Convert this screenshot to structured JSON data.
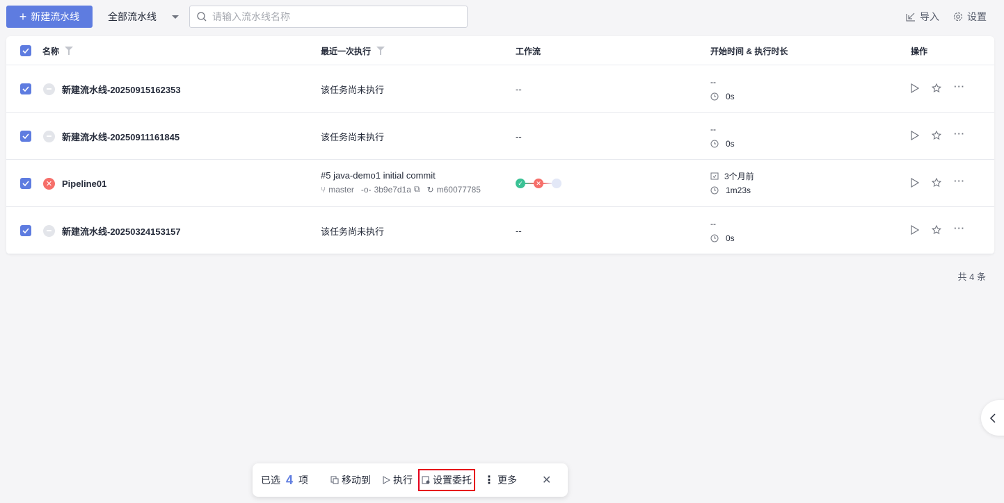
{
  "toolbar": {
    "new_label": "新建流水线",
    "scope": "全部流水线",
    "search_placeholder": "请输入流水线名称",
    "import_label": "导入",
    "settings_label": "设置"
  },
  "table": {
    "headers": {
      "name": "名称",
      "last_run": "最近一次执行",
      "workflow": "工作流",
      "time": "开始时间 & 执行时长",
      "actions": "操作"
    },
    "rows": [
      {
        "name": "新建流水线-20250915162353",
        "status": "not-run",
        "last_run": "该任务尚未执行",
        "workflow": "--",
        "start": "--",
        "duration": "0s"
      },
      {
        "name": "新建流水线-20250911161845",
        "status": "not-run",
        "last_run": "该任务尚未执行",
        "workflow": "--",
        "start": "--",
        "duration": "0s"
      },
      {
        "name": "Pipeline01",
        "status": "failed",
        "last_run": "#5 java-demo1 initial commit",
        "branch": "master",
        "commit": "3b9e7d1a",
        "user": "m60077785",
        "start": "3个月前",
        "duration": "1m23s"
      },
      {
        "name": "新建流水线-20250324153157",
        "status": "not-run",
        "last_run": "该任务尚未执行",
        "workflow": "--",
        "start": "--",
        "duration": "0s"
      }
    ]
  },
  "footer": {
    "total": "共 4 条"
  },
  "batch": {
    "selected_prefix": "已选",
    "count": "4",
    "selected_suffix": "项",
    "move": "移动到",
    "run": "执行",
    "delegate": "设置委托",
    "more": "更多"
  },
  "colors": {
    "primary": "#5e7ce0",
    "success": "#3ac295",
    "danger": "#f66f6a"
  }
}
